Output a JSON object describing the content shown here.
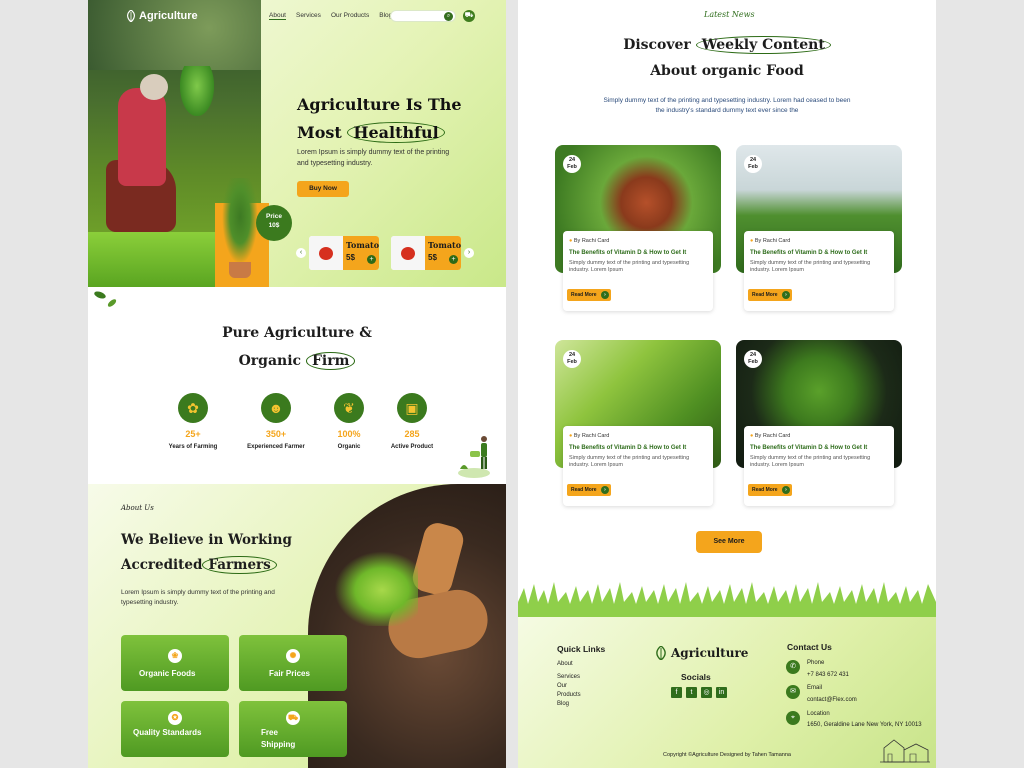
{
  "brand": {
    "name": "Agriculture"
  },
  "nav": {
    "items": [
      "About",
      "Services",
      "Our Products",
      "Blog"
    ]
  },
  "hero": {
    "title_line1": "Agriculture Is The",
    "title_most": "Most",
    "title_circled": "Healthful",
    "text": "Lorem Ipsum is simply dummy text of the printing and typesetting industry.",
    "cta": "Buy Now",
    "price_label": "Price",
    "price_value": "10$",
    "products": [
      {
        "name": "Tomato",
        "price": "5$"
      },
      {
        "name": "Tomato",
        "price": "5$"
      }
    ]
  },
  "pure": {
    "line1": "Pure Agriculture &",
    "line2_pre": "Organic",
    "line2_circled": "Firm",
    "stats": [
      {
        "num": "25+",
        "label": "Years of Farming"
      },
      {
        "num": "350+",
        "label": "Experienced Farmer"
      },
      {
        "num": "100%",
        "label": "Organic"
      },
      {
        "num": "285",
        "label": "Active Product"
      }
    ]
  },
  "about": {
    "tag": "About Us",
    "line1": "We Believe in Working",
    "line2_pre": "Accredited",
    "line2_circled": "Farmers",
    "text": "Lorem Ipsum is simply dummy text of the printing and typesetting industry.",
    "features": [
      "Organic Foods",
      "Fair Prices",
      "Quality Standards",
      "Free Shipping"
    ]
  },
  "news": {
    "tag": "Latest News",
    "line1_pre": "Discover",
    "line1_circled": "Weekly Content",
    "line2": "About organic Food",
    "subtitle": "Simply dummy text of the printing and typesetting industry. Lorem had ceased to been the industry's standard dummy text ever since the",
    "posts": [
      {
        "day": "24",
        "month": "Feb",
        "author": "Rachi Card",
        "title": "The Benefits of Vitamin D & How to Get It",
        "text": "Simply dummy text of the printing and typesetting industry. Lorem Ipsum",
        "cta": "Read More"
      },
      {
        "day": "24",
        "month": "Feb",
        "author": "Rachi Card",
        "title": "The Benefits of Vitamin D & How to Get It",
        "text": "Simply dummy text of the printing and typesetting industry. Lorem Ipsum",
        "cta": "Read More"
      },
      {
        "day": "24",
        "month": "Feb",
        "author": "Rachi Card",
        "title": "The Benefits of Vitamin D & How to Get It",
        "text": "Simply dummy text of the printing and typesetting industry. Lorem Ipsum",
        "cta": "Read More"
      },
      {
        "day": "24",
        "month": "Feb",
        "author": "Rachi Card",
        "title": "The Benefits of Vitamin D & How to Get It",
        "text": "Simply dummy text of the printing and typesetting industry. Lorem Ipsum",
        "cta": "Read More"
      }
    ],
    "see_more": "See More"
  },
  "footer": {
    "quick_links_title": "Quick Links",
    "quick_links": [
      "About",
      "Services",
      "Our",
      "Products",
      "Blog"
    ],
    "socials_title": "Socials",
    "contact_title": "Contact Us",
    "phone_label": "Phone",
    "phone": "+7 843 672 431",
    "email_label": "Email",
    "email": "contact@Flex.com",
    "location_label": "Location",
    "location": "1650, Geraldine Lane New York, NY 10013",
    "copyright": "Copyright ©Agriculture   Designed by Tahen Tamanna"
  },
  "colors": {
    "green": "#3b7a1e",
    "orange": "#f4a51c",
    "light_green": "#e4f3b5"
  }
}
